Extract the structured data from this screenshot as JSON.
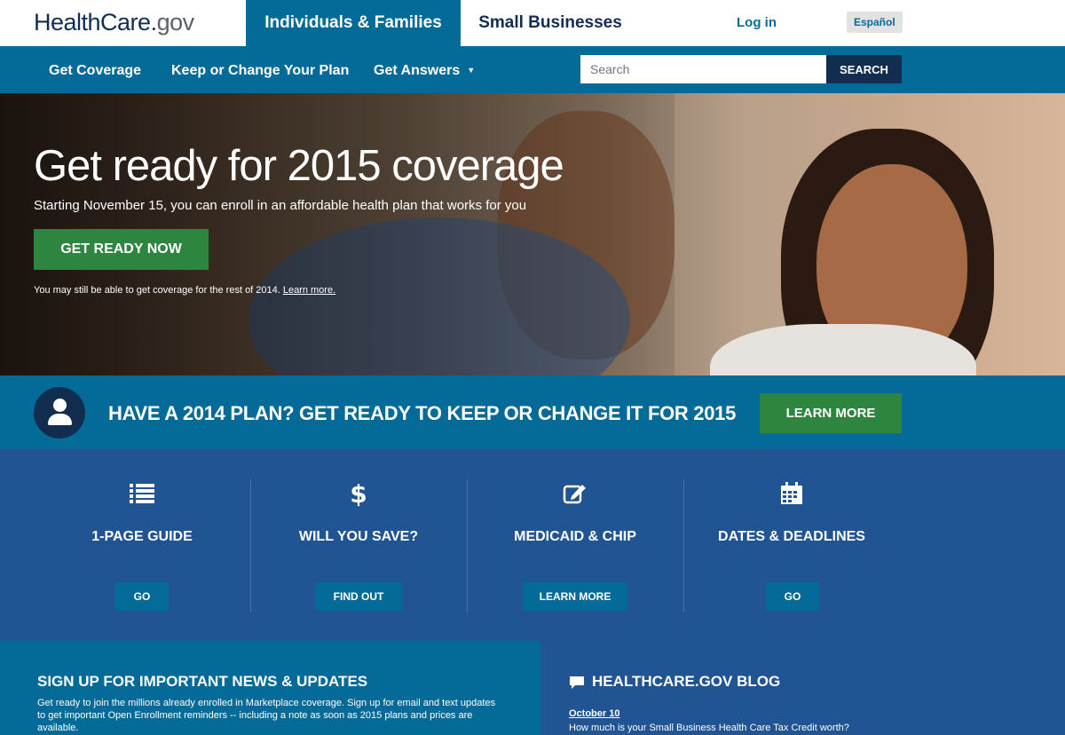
{
  "header": {
    "logo_main": "HealthCare",
    "logo_dot": ".",
    "logo_tld": "gov",
    "tab_individuals": "Individuals & Families",
    "tab_small_business": "Small Businesses",
    "login": "Log in",
    "language": "Español"
  },
  "nav": {
    "items": [
      "Get Coverage",
      "Keep or Change Your Plan",
      "Get Answers"
    ],
    "search_placeholder": "Search",
    "search_button": "SEARCH"
  },
  "hero": {
    "title": "Get ready for 2015 coverage",
    "subtitle": "Starting November 15, you can enroll in an affordable health plan that works for you",
    "button": "GET READY NOW",
    "note": "You may still be able to get coverage for the rest of 2014.",
    "note_link": "Learn more."
  },
  "plan_banner": {
    "text": "HAVE A 2014 PLAN? GET READY TO KEEP OR CHANGE IT FOR 2015",
    "button": "LEARN MORE"
  },
  "tools": [
    {
      "icon": "list-icon",
      "title": "1-PAGE GUIDE",
      "button": "GO"
    },
    {
      "icon": "dollar-icon",
      "title": "WILL YOU SAVE?",
      "button": "FIND OUT"
    },
    {
      "icon": "edit-icon",
      "title": "MEDICAID & CHIP",
      "button": "LEARN MORE"
    },
    {
      "icon": "calendar-icon",
      "title": "DATES & DEADLINES",
      "button": "GO"
    }
  ],
  "news": {
    "title": "SIGN UP FOR IMPORTANT NEWS & UPDATES",
    "body": "Get ready to join the millions already enrolled in Marketplace coverage. Sign up for email and text updates to get important Open Enrollment reminders -- including a note as soon as 2015 plans and prices are available."
  },
  "blog": {
    "title": "HEALTHCARE.GOV BLOG",
    "date": "October 10",
    "post": "How much is your Small Business Health Care Tax Credit worth?"
  },
  "colors": {
    "navy": "#112e51",
    "blue": "#046b99",
    "mid_blue": "#205493",
    "green": "#2e8540"
  }
}
